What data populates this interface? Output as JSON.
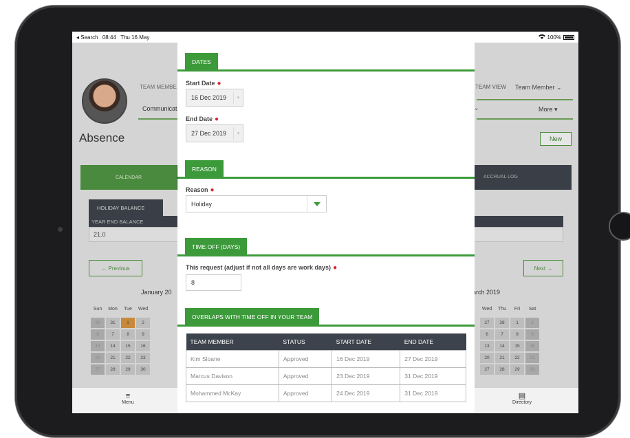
{
  "status_bar": {
    "back_label": "◂ Search",
    "time": "08:44",
    "date": "Thu 16 May",
    "battery": "100%"
  },
  "background": {
    "team_members_label": "TEAM MEMBE",
    "communications_label": "Communicat",
    "page_title": "Absence",
    "team_view_label": "TEAM VIEW",
    "team_member_menu": "Team Member",
    "more_label": "More",
    "new_button": "New",
    "calendar_tab": "CALENDAR",
    "accrual_tab": "ACCRUAL LOG",
    "holiday_balance_label": "HOLIDAY BALANCE",
    "year_end_balance_label": "YEAR END BALANCE",
    "year_end_balance_value": "21.0",
    "previous_button": "← Previous",
    "next_button": "Next →",
    "left_month": "January 20",
    "right_month": "arch 2019",
    "left_dow": [
      "Sun",
      "Mon",
      "Tue",
      "Wed"
    ],
    "right_dow": [
      "Wed",
      "Thu",
      "Fri",
      "Sat"
    ],
    "left_cal": [
      [
        "30",
        "31",
        "1",
        "2"
      ],
      [
        "6",
        "7",
        "8",
        "9"
      ],
      [
        "13",
        "14",
        "15",
        "16"
      ],
      [
        "20",
        "21",
        "22",
        "23"
      ],
      [
        "27",
        "28",
        "29",
        "30"
      ]
    ],
    "right_cal": [
      [
        "27",
        "28",
        "1",
        "2"
      ],
      [
        "6",
        "7",
        "8",
        "9"
      ],
      [
        "13",
        "14",
        "15",
        "16"
      ],
      [
        "20",
        "21",
        "22",
        "23"
      ],
      [
        "27",
        "28",
        "29",
        "30"
      ]
    ],
    "menu_tab": "Menu",
    "directory_tab": "Directory"
  },
  "modal": {
    "dates_section": "DATES",
    "start_date_label": "Start Date",
    "start_date_value": "16 Dec 2019",
    "end_date_label": "End Date",
    "end_date_value": "27 Dec 2019",
    "reason_section": "REASON",
    "reason_label": "Reason",
    "reason_value": "Holiday",
    "time_off_section": "TIME OFF (DAYS)",
    "request_label": "This request (adjust if not all days are work days)",
    "request_value": "8",
    "overlaps_section": "OVERLAPS WITH TIME OFF IN YOUR TEAM",
    "table_headers": [
      "TEAM MEMBER",
      "STATUS",
      "START DATE",
      "END DATE"
    ],
    "table_rows": [
      [
        "Kim Sloane",
        "Approved",
        "16 Dec 2019",
        "27 Dec 2019"
      ],
      [
        "Marcus Davison",
        "Approved",
        "23 Dec 2019",
        "31 Dec 2019"
      ],
      [
        "Mohammed McKay",
        "Approved",
        "24 Dec 2019",
        "31 Dec 2019"
      ]
    ]
  },
  "colors": {
    "accent_green": "#3c9a3a",
    "required_red": "#d9252a",
    "header_dark": "#3c434c"
  }
}
